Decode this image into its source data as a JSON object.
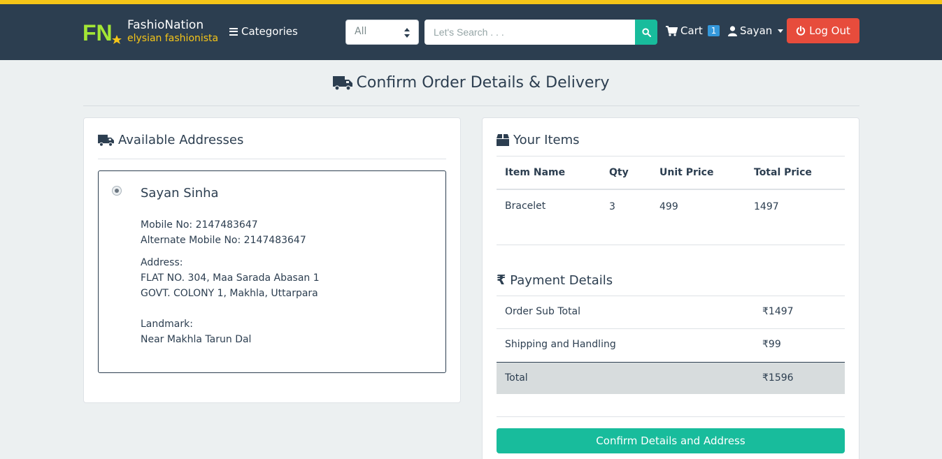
{
  "brand": {
    "logo_text": "FN",
    "name": "FashioNation",
    "tagline": "elysian fashionista"
  },
  "nav": {
    "categories_label": "Categories",
    "search_select": "All",
    "search_placeholder": "Let's Search . . .",
    "cart_label": "Cart",
    "cart_count": "1",
    "user_name": "Sayan",
    "logout_label": "Log Out"
  },
  "page": {
    "title": "Confirm Order Details & Delivery"
  },
  "addresses": {
    "heading": "Available Addresses",
    "selected": {
      "name": "Sayan Sinha",
      "mobile": "Mobile No: 2147483647",
      "alt_mobile": "Alternate Mobile No: 2147483647",
      "address_label": "Address:",
      "address_line1": "FLAT NO. 304, Maa Sarada Abasan 1",
      "address_line2": "GOVT. COLONY 1, Makhla, Uttarpara",
      "landmark_label": "Landmark:",
      "landmark": "Near Makhla Tarun Dal"
    }
  },
  "items": {
    "heading": "Your Items",
    "columns": [
      "Item Name",
      "Qty",
      "Unit Price",
      "Total Price"
    ],
    "rows": [
      {
        "name": "Bracelet",
        "qty": "3",
        "unit_price": "499",
        "total_price": "1497"
      }
    ]
  },
  "payment": {
    "heading": "Payment Details",
    "rows": [
      {
        "label": "Order Sub Total",
        "value": "₹1497"
      },
      {
        "label": "Shipping and Handling",
        "value": "₹99"
      },
      {
        "label": "Total",
        "value": "₹1596"
      }
    ]
  },
  "confirm_button": "Confirm Details and Address",
  "colors": {
    "navbar": "#2c3e50",
    "accent_yellow": "#f5c518",
    "success": "#18bc9c",
    "danger": "#e74c3c",
    "info": "#3498db",
    "logo_green": "#a3e635"
  }
}
